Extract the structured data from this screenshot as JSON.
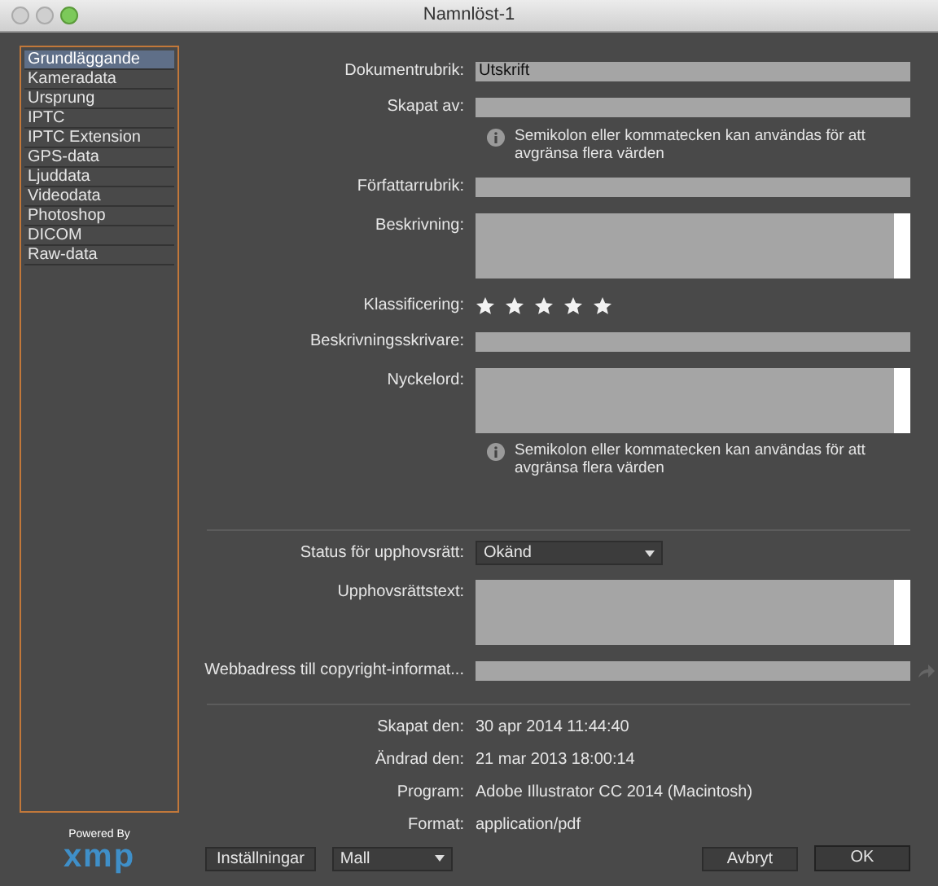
{
  "window": {
    "title": "Namnlöst-1"
  },
  "sidebar": {
    "items": [
      {
        "label": "Grundläggande",
        "selected": true
      },
      {
        "label": "Kameradata",
        "selected": false
      },
      {
        "label": "Ursprung",
        "selected": false
      },
      {
        "label": "IPTC",
        "selected": false
      },
      {
        "label": "IPTC Extension",
        "selected": false
      },
      {
        "label": "GPS-data",
        "selected": false
      },
      {
        "label": "Ljuddata",
        "selected": false
      },
      {
        "label": "Videodata",
        "selected": false
      },
      {
        "label": "Photoshop",
        "selected": false
      },
      {
        "label": "DICOM",
        "selected": false
      },
      {
        "label": "Raw-data",
        "selected": false
      }
    ]
  },
  "logo": {
    "caption": "Powered By",
    "wordmark": "xmp"
  },
  "form": [
    {
      "kind": "field",
      "label": "Dokumentrubrik:",
      "value": "Utskrift"
    },
    {
      "kind": "field",
      "label": "Skapat av:"
    },
    {
      "kind": "note",
      "text": "Semikolon eller kommatecken kan användas för att avgränsa flera värden"
    },
    {
      "kind": "field",
      "label": "Författarrubrik:"
    },
    {
      "kind": "area",
      "label": "Beskrivning:"
    },
    {
      "kind": "stars",
      "label": "Klassificering:",
      "stars": 5
    },
    {
      "kind": "field",
      "label": "Beskrivningsskrivare:"
    },
    {
      "kind": "area",
      "label": "Nyckelord:"
    },
    {
      "kind": "note",
      "text": "Semikolon eller kommatecken kan användas för att avgränsa flera värden"
    },
    {
      "kind": "divider"
    },
    {
      "kind": "select",
      "label": "Status för upphovsrätt:",
      "value": "Okänd"
    },
    {
      "kind": "area",
      "label": "Upphovsrättstext:"
    },
    {
      "kind": "link",
      "label": "Webbadress till copyright-informat..."
    },
    {
      "kind": "divider"
    },
    {
      "kind": "info",
      "label": "Skapat den:",
      "value": "30 apr 2014 11:44:40"
    },
    {
      "kind": "info",
      "label": "Ändrad den:",
      "value": "21 mar 2013 18:00:14"
    },
    {
      "kind": "info",
      "label": "Program:",
      "value": "Adobe Illustrator CC 2014 (Macintosh)"
    },
    {
      "kind": "info",
      "label": "Format:",
      "value": "application/pdf"
    }
  ],
  "footer": {
    "settings_button": "Inställningar",
    "template_select": "Mall",
    "cancel_button": "Avbryt",
    "ok_button": "OK"
  }
}
